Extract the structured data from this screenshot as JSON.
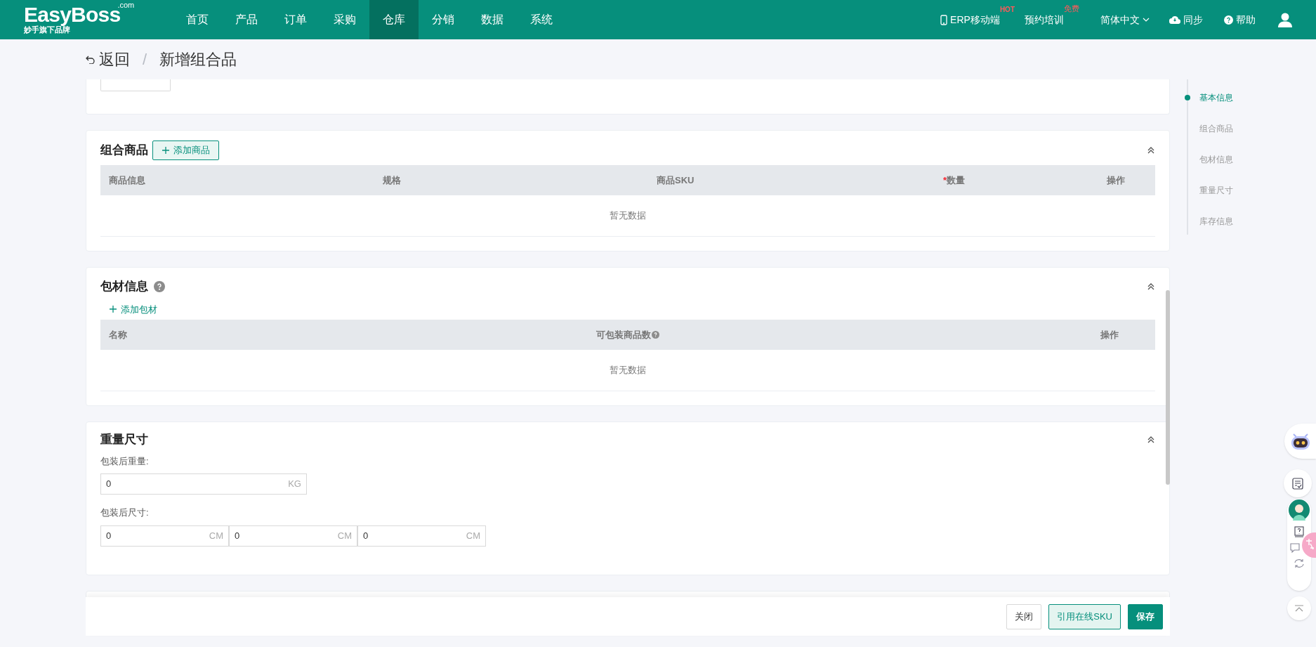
{
  "nav": {
    "logo": "EasyBoss",
    "logo_suffix": ".com",
    "tagline": "妙手旗下品牌",
    "menu": [
      {
        "label": "首页",
        "selected": false
      },
      {
        "label": "产品",
        "selected": false
      },
      {
        "label": "订单",
        "selected": false
      },
      {
        "label": "采购",
        "selected": false
      },
      {
        "label": "仓库",
        "selected": true
      },
      {
        "label": "分销",
        "selected": false
      },
      {
        "label": "数据",
        "selected": false
      },
      {
        "label": "系统",
        "selected": false
      }
    ],
    "actions": [
      {
        "kind": "mobile",
        "label": "ERP移动端",
        "badge": "HOT"
      },
      {
        "kind": "training",
        "label": "预约培训",
        "badge": "免费"
      },
      {
        "kind": "language",
        "label": "简体中文"
      },
      {
        "kind": "sync",
        "label": "同步"
      },
      {
        "kind": "help",
        "label": "帮助"
      },
      {
        "kind": "user"
      }
    ]
  },
  "breadcrumb": {
    "back": "返回",
    "separator": "/",
    "title": "新增组合品"
  },
  "anchors": [
    {
      "label": "基本信息",
      "selected": true
    },
    {
      "label": "组合商品",
      "selected": false
    },
    {
      "label": "包材信息",
      "selected": false
    },
    {
      "label": "重量尺寸",
      "selected": false
    },
    {
      "label": "库存信息",
      "selected": false
    }
  ],
  "combo": {
    "title": "组合商品",
    "add_button": "添加商品",
    "required_mark": "*",
    "columns": [
      {
        "label": "商品信息",
        "required": false
      },
      {
        "label": "规格",
        "required": false
      },
      {
        "label": "商品SKU",
        "required": false
      },
      {
        "label": "数量",
        "required": true
      },
      {
        "label": "操作",
        "required": false
      }
    ],
    "empty_text": "暂无数据"
  },
  "packaging": {
    "title": "包材信息",
    "add_link": "添加包材",
    "columns": [
      {
        "label": "名称",
        "help": false
      },
      {
        "label": "可包装商品数",
        "help": true
      },
      {
        "label": "操作",
        "help": false
      }
    ],
    "empty_text": "暂无数据"
  },
  "weight": {
    "title": "重量尺寸",
    "weight_label": "包装后重量:",
    "weight_field": {
      "value": "0",
      "unit": "KG"
    },
    "size_label": "包装后尺寸:",
    "size_fields": [
      {
        "value": "0",
        "unit": "CM"
      },
      {
        "value": "0",
        "unit": "CM"
      },
      {
        "value": "0",
        "unit": "CM"
      }
    ]
  },
  "footer": [
    {
      "label": "关闭",
      "kind": "default"
    },
    {
      "label": "引用在线SKU",
      "kind": "secondary"
    },
    {
      "label": "保存",
      "kind": "primary"
    }
  ]
}
